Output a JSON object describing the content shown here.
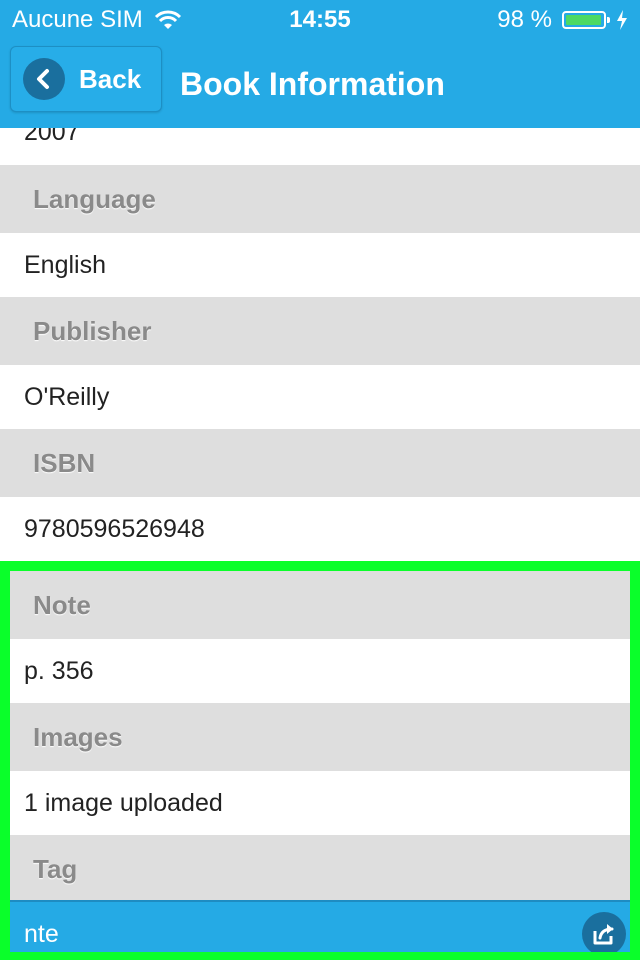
{
  "status_bar": {
    "carrier": "Aucune SIM",
    "time": "14:55",
    "battery_text": "98 %",
    "battery_level": 0.98,
    "wifi_icon": "wifi-icon",
    "charging_icon": "bolt-icon"
  },
  "nav": {
    "back_label": "Back",
    "back_icon": "chevron-left-icon",
    "title": "Book Information"
  },
  "fields": [
    {
      "header": "",
      "value": "2007"
    },
    {
      "header": "Language",
      "value": "English"
    },
    {
      "header": "Publisher",
      "value": "O'Reilly"
    },
    {
      "header": "ISBN",
      "value": "9780596526948"
    },
    {
      "header": "Note",
      "value": "p. 356"
    },
    {
      "header": "Images",
      "value": "1 image uploaded"
    },
    {
      "header": "Tag",
      "value": "nte"
    }
  ],
  "colors": {
    "accent": "#25aae5",
    "header_bg": "#dedede",
    "highlight": "#0aff2a",
    "icon_circle": "#1a6f9e"
  },
  "tag_action_icon": "share-icon"
}
